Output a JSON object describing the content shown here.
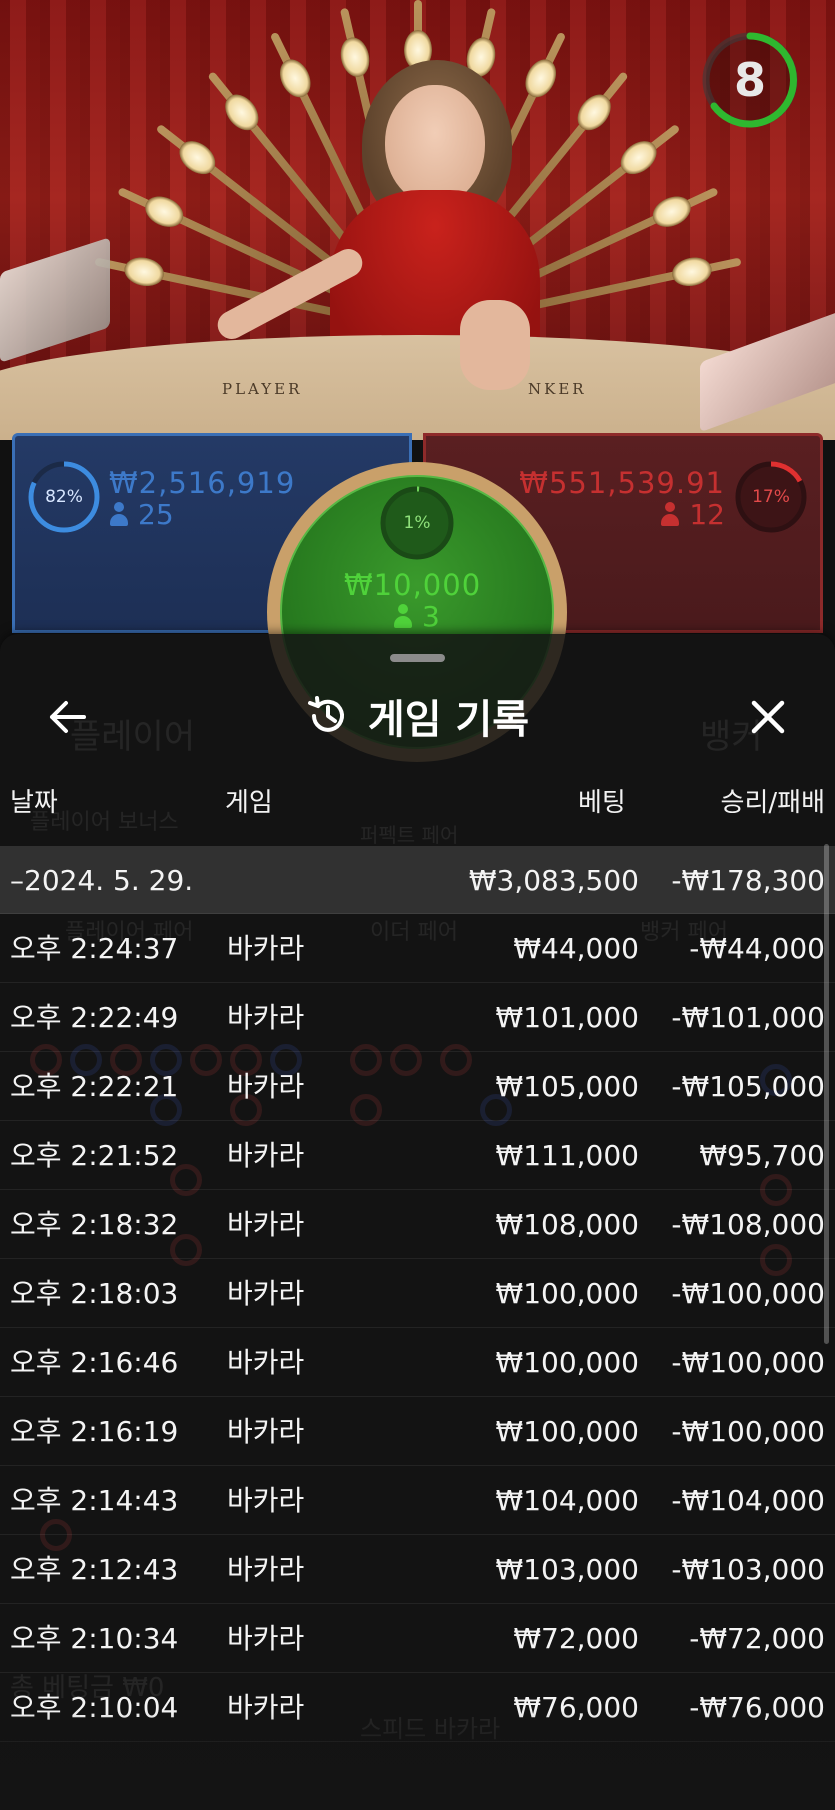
{
  "live_table": {
    "countdown": "8",
    "table_labels": {
      "player": "PLAYER",
      "banker": "NKER"
    },
    "player_bet": {
      "percent": "82%",
      "percent_value": 0.82,
      "amount": "₩2,516,919",
      "players": "25",
      "color": "#3a6fb6"
    },
    "tie_bet": {
      "percent": "1%",
      "percent_value": 0.01,
      "amount": "₩10,000",
      "players": "3",
      "color": "#57b845"
    },
    "banker_bet": {
      "percent": "17%",
      "percent_value": 0.17,
      "amount": "₩551,539.91",
      "players": "12",
      "color": "#e03030"
    }
  },
  "history_sheet": {
    "title": "게임 기록",
    "title_icon": "history-icon",
    "back_icon": "arrow-left-icon",
    "close_icon": "close-icon",
    "columns": {
      "date": "날짜",
      "game": "게임",
      "bet": "베팅",
      "result": "승리/패배"
    },
    "date_group": {
      "label": "–2024. 5. 29.",
      "bet": "₩3,083,500",
      "result": "-₩178,300"
    },
    "rows": [
      {
        "time": "오후 2:24:37",
        "game": "바카라",
        "bet": "₩44,000",
        "result": "-₩44,000"
      },
      {
        "time": "오후 2:22:49",
        "game": "바카라",
        "bet": "₩101,000",
        "result": "-₩101,000"
      },
      {
        "time": "오후 2:22:21",
        "game": "바카라",
        "bet": "₩105,000",
        "result": "-₩105,000"
      },
      {
        "time": "오후 2:21:52",
        "game": "바카라",
        "bet": "₩111,000",
        "result": "₩95,700"
      },
      {
        "time": "오후 2:18:32",
        "game": "바카라",
        "bet": "₩108,000",
        "result": "-₩108,000"
      },
      {
        "time": "오후 2:18:03",
        "game": "바카라",
        "bet": "₩100,000",
        "result": "-₩100,000"
      },
      {
        "time": "오후 2:16:46",
        "game": "바카라",
        "bet": "₩100,000",
        "result": "-₩100,000"
      },
      {
        "time": "오후 2:16:19",
        "game": "바카라",
        "bet": "₩100,000",
        "result": "-₩100,000"
      },
      {
        "time": "오후 2:14:43",
        "game": "바카라",
        "bet": "₩104,000",
        "result": "-₩104,000"
      },
      {
        "time": "오후 2:12:43",
        "game": "바카라",
        "bet": "₩103,000",
        "result": "-₩103,000"
      },
      {
        "time": "오후 2:10:34",
        "game": "바카라",
        "bet": "₩72,000",
        "result": "-₩72,000"
      },
      {
        "time": "오후 2:10:04",
        "game": "바카라",
        "bet": "₩76,000",
        "result": "-₩76,000"
      }
    ]
  },
  "background_ui": {
    "player_tab": "플레이어",
    "banker_tab": "뱅커",
    "player_bonus": "플레이어 보너스",
    "perfect_pair": "퍼펙트 페어",
    "player_pair": "플레이어 페어",
    "either_pair": "이더 페어",
    "banker_pair": "뱅커 페어",
    "total_bet": "총 베팅금 ₩0",
    "game_name": "스피드 바카라"
  }
}
